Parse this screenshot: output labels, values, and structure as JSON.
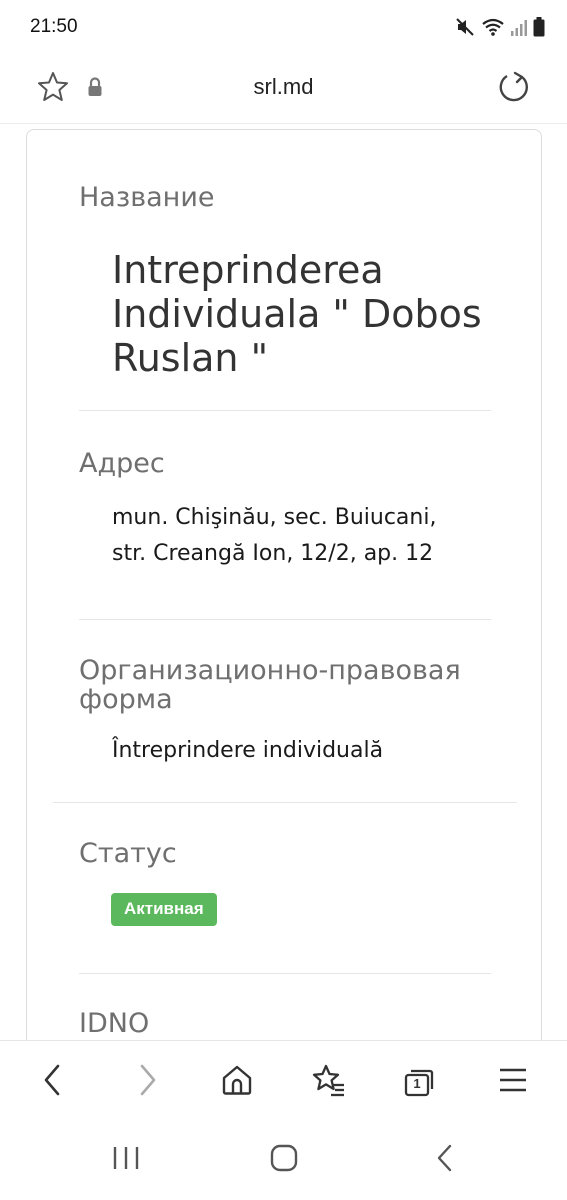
{
  "status_bar": {
    "time": "21:50"
  },
  "browser": {
    "url": "srl.md"
  },
  "company": {
    "name_label": "Название",
    "name_lines": [
      "Intreprinderea",
      "Individuala \" Dobos",
      "Ruslan \""
    ],
    "address_label": "Адрес",
    "address_lines": [
      "mun. Chişinău, sec. Buiucani,",
      "str. Creangă Ion, 12/2, ap. 12"
    ],
    "legal_form_label_lines": [
      "Организационно-правовая",
      "форма"
    ],
    "legal_form_value": "Întreprindere individuală",
    "status_label": "Статус",
    "status_value": "Активная",
    "status_color": "#5cb85c",
    "idno_label": "IDNO"
  },
  "toolbar": {
    "icons": [
      "back-icon",
      "forward-icon",
      "home-icon",
      "bookmarks-icon",
      "tabs-icon",
      "menu-icon"
    ],
    "tabs_count": "1"
  },
  "system_nav": {
    "icons": [
      "recent-apps-icon",
      "home-icon",
      "back-icon"
    ]
  }
}
